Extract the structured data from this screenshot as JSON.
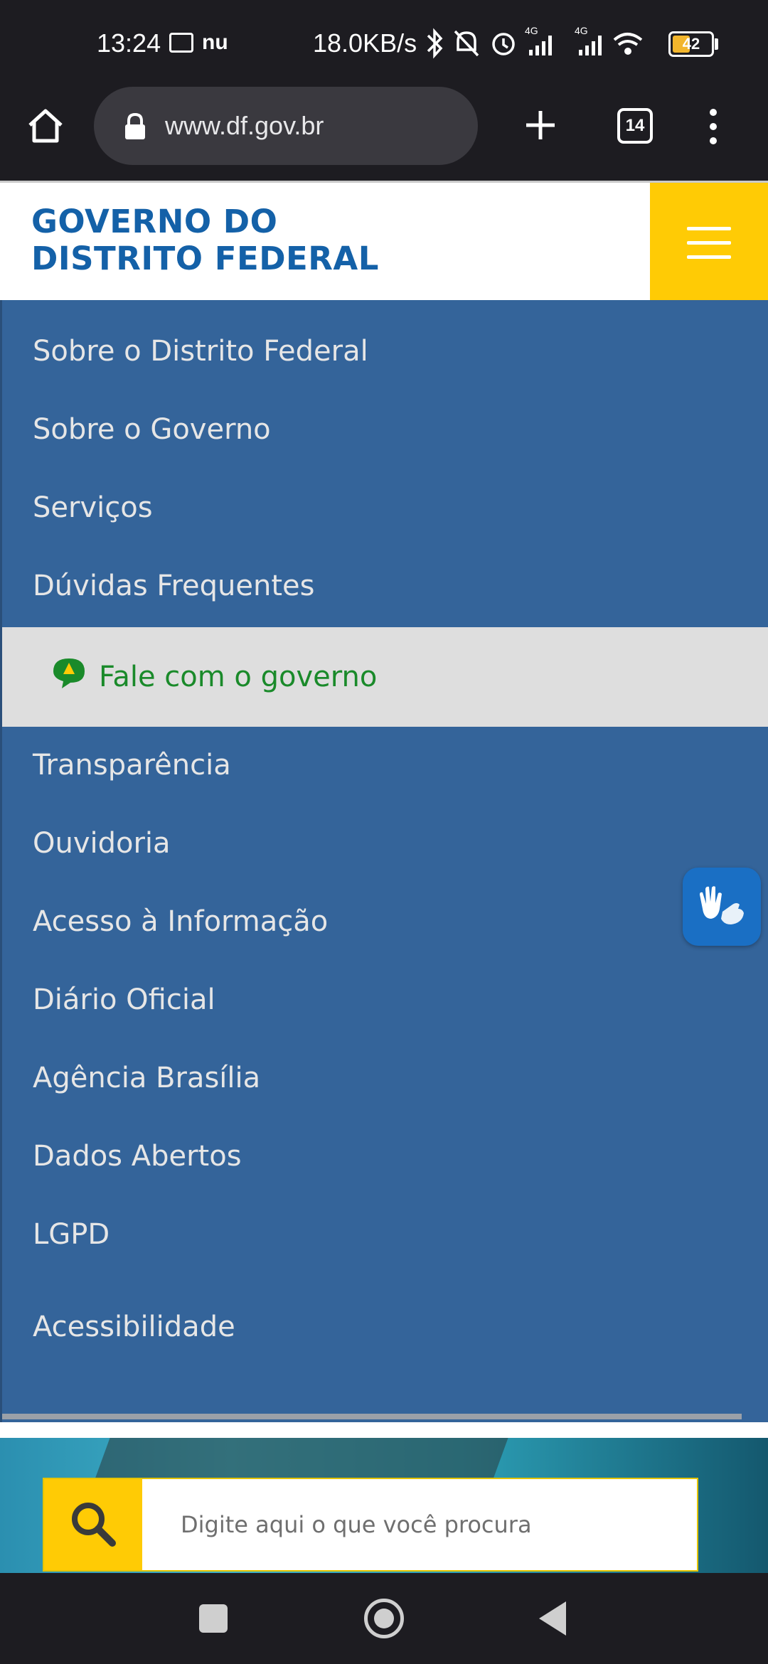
{
  "status_bar": {
    "time": "13:24",
    "carrier_icon": "nu",
    "net_speed": "18.0KB/s",
    "network_label_1": "4G",
    "network_label_2": "4G",
    "battery": "42"
  },
  "browser": {
    "url": "www.df.gov.br",
    "tab_count": "14",
    "icons": [
      "home-icon",
      "lock-icon",
      "plus-icon",
      "tabs-icon",
      "more-vert-icon"
    ]
  },
  "header": {
    "logo_line_1": "GOVERNO DO",
    "logo_line_2": "DISTRITO FEDERAL",
    "accent_color": "#ffcb05",
    "brand_color": "#1461a8"
  },
  "menu": {
    "items_top": [
      "Sobre o Distrito Federal",
      "Sobre o Governo",
      "Serviços",
      "Dúvidas Frequentes"
    ],
    "highlight": "Fale com o governo",
    "items_bottom": [
      "Transparência",
      "Ouvidoria",
      "Acesso à Informação",
      "Diário Oficial",
      "Agência Brasília",
      "Dados Abertos",
      "LGPD",
      "Acessibilidade"
    ],
    "background_color": "#34649a"
  },
  "search": {
    "placeholder": "Digite aqui o que você procura"
  }
}
